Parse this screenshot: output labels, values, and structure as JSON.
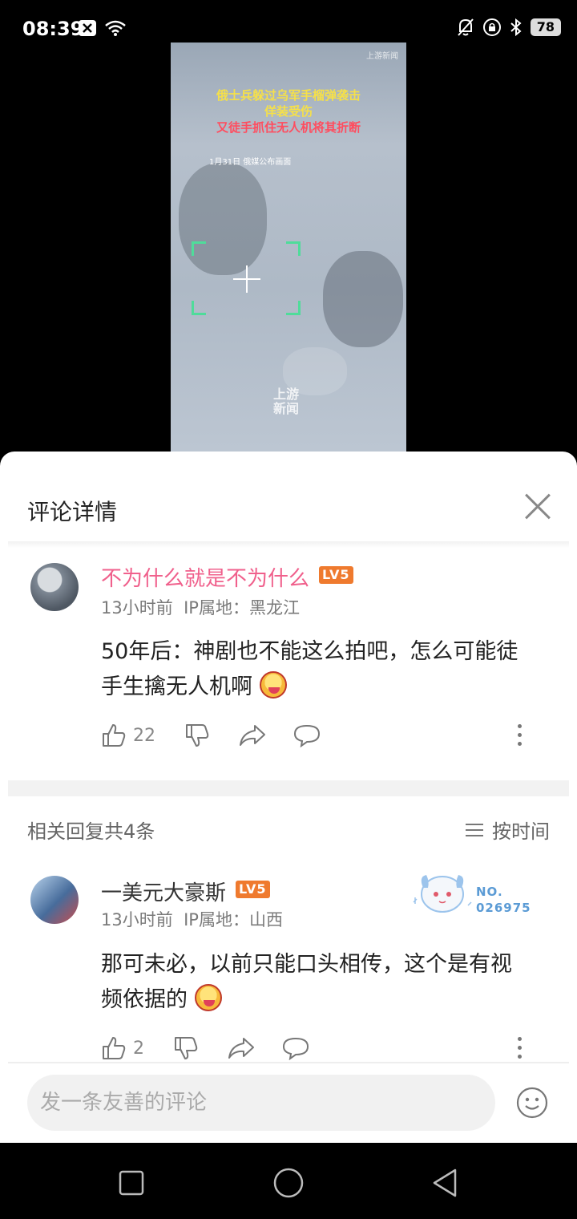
{
  "status": {
    "time": "08:39",
    "battery": "78",
    "icons": [
      "close-box-icon",
      "wifi-icon",
      "bell-off-icon",
      "lock-rotation-icon",
      "bluetooth-icon",
      "battery-icon"
    ]
  },
  "video": {
    "watermark_top": "上游新闻",
    "caption_line1": "俄士兵躲过乌军手榴弹袭击",
    "caption_line2": "佯装受伤",
    "caption_line3": "又徒手抓住无人机将其折断",
    "date_text": "1月31日 俄媒公布画面",
    "watermark_center_1": "上游",
    "watermark_center_2": "新闻",
    "caption_colors": {
      "yellow": "#f5e04a",
      "red": "#ff4d5f"
    }
  },
  "panel": {
    "title": "评论详情",
    "close_icon": "close-icon"
  },
  "main_comment": {
    "username": "不为什么就是不为什么",
    "username_color": "#f0608c",
    "level": "LV5",
    "time": "13小时前",
    "ip_label": "IP属地：黑龙江",
    "text_line1": "50年后：神剧也不能这么拍吧，怎么可能徒",
    "text_line2": "手生擒无人机啊",
    "likes": "22"
  },
  "replies_header": {
    "count_text": "相关回复共4条",
    "sort_label": "按时间"
  },
  "reply": {
    "username": "一美元大豪斯",
    "level": "LV5",
    "time": "13小时前",
    "ip_label": "IP属地：山西",
    "no_label": "NO.",
    "no_number": "026975",
    "text_line1": "那可未必，以前只能口头相传，这个是有视",
    "text_line2": "频依据的",
    "likes": "2"
  },
  "input": {
    "placeholder": "发一条友善的评论"
  }
}
